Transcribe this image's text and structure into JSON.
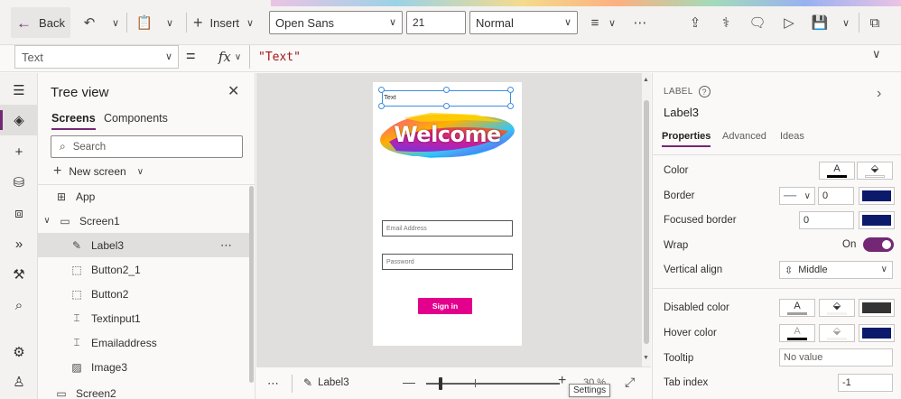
{
  "toolbar": {
    "back_label": "Back",
    "insert_label": "Insert",
    "font_family": "Open Sans",
    "font_size": "21",
    "font_weight": "Normal"
  },
  "formula": {
    "property": "Text",
    "equals": "=",
    "fx": "fx",
    "expression": "\"Text\""
  },
  "tree": {
    "title": "Tree view",
    "tabs": [
      "Screens",
      "Components"
    ],
    "search_placeholder": "Search",
    "new_screen_label": "New screen",
    "items": [
      {
        "label": "App",
        "icon": "app-icon"
      },
      {
        "label": "Screen1",
        "icon": "screen-icon"
      },
      {
        "label": "Label3",
        "icon": "label-edit-icon"
      },
      {
        "label": "Button2_1",
        "icon": "button-icon"
      },
      {
        "label": "Button2",
        "icon": "button-icon"
      },
      {
        "label": "Textinput1",
        "icon": "textinput-icon"
      },
      {
        "label": "Emailaddress",
        "icon": "textinput-icon"
      },
      {
        "label": "Image3",
        "icon": "image-icon"
      },
      {
        "label": "Screen2",
        "icon": "screen-icon"
      }
    ]
  },
  "canvas": {
    "label_text": "Text",
    "welcome_text": "Welcome",
    "email_placeholder": "Email Address",
    "password_placeholder": "Password",
    "signin_label": "Sign in"
  },
  "footer": {
    "selected_control": "Label3",
    "zoom_text": "30 %",
    "tooltip": "Settings",
    "zoom_level": 0.11
  },
  "properties": {
    "type_label": "LABEL",
    "control_name": "Label3",
    "tabs": [
      "Properties",
      "Advanced",
      "Ideas"
    ],
    "color_label": "Color",
    "border_label": "Border",
    "border_width": "0",
    "focused_border_label": "Focused border",
    "focused_border_width": "0",
    "wrap_label": "Wrap",
    "wrap_state": "On",
    "vertical_align_label": "Vertical align",
    "vertical_align_value": "Middle",
    "disabled_color_label": "Disabled color",
    "hover_color_label": "Hover color",
    "tooltip_label": "Tooltip",
    "tooltip_value": "No value",
    "tab_index_label": "Tab index",
    "tab_index_value": "-1"
  },
  "colors": {
    "accent": "#742774",
    "border_color": "#0b1a6b",
    "signin_bg": "#e3008c",
    "disabled_fill": "#333333",
    "selection": "#3f8ede"
  }
}
